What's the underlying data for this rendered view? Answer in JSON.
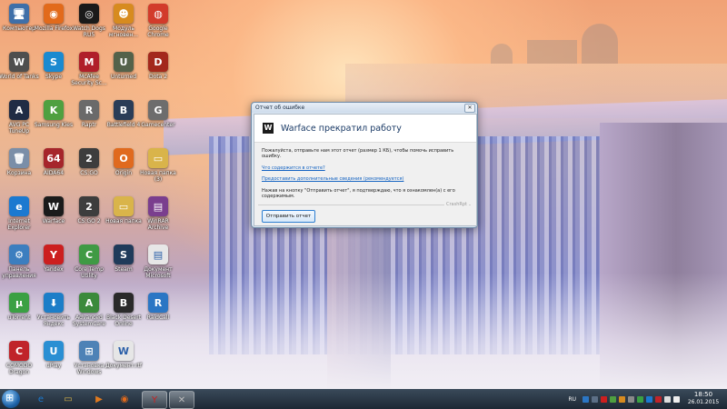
{
  "desktop": {
    "icons": [
      {
        "label": "Компьютер",
        "glyph": "🖥",
        "color": "#3f6fa8"
      },
      {
        "label": "Mozilla Firefox",
        "glyph": "◉",
        "color": "#e26a1b"
      },
      {
        "label": "Watch Dogs RU5",
        "glyph": "◎",
        "color": "#1a1a1a"
      },
      {
        "label": "Модуль мгновен...",
        "glyph": "☻",
        "color": "#d78b1f"
      },
      {
        "label": "Google Chrome",
        "glyph": "◍",
        "color": "#d23b2b"
      },
      {
        "label": "World of Tanks",
        "glyph": "W",
        "color": "#4e4e4e"
      },
      {
        "label": "Skype",
        "glyph": "S",
        "color": "#1b8ad0"
      },
      {
        "label": "McAfee Security Sc...",
        "glyph": "M",
        "color": "#b01e2a"
      },
      {
        "label": "Unturned",
        "glyph": "U",
        "color": "#54624a"
      },
      {
        "label": "Dota 2",
        "glyph": "D",
        "color": "#a3281c"
      },
      {
        "label": "AVG PC TuneUp",
        "glyph": "A",
        "color": "#202c44"
      },
      {
        "label": "Samsung Kies",
        "glyph": "K",
        "color": "#4fa040"
      },
      {
        "label": "Raptr",
        "glyph": "R",
        "color": "#6a6a6a"
      },
      {
        "label": "Battlefield 4",
        "glyph": "B",
        "color": "#2b3d57"
      },
      {
        "label": "Gamecenter",
        "glyph": "G",
        "color": "#6d6d6d"
      },
      {
        "label": "Корзина",
        "glyph": "🗑",
        "color": "#7a8ea8"
      },
      {
        "label": "AIDA64",
        "glyph": "64",
        "color": "#a6262b"
      },
      {
        "label": "CS:GO",
        "glyph": "2",
        "color": "#3d3d3d"
      },
      {
        "label": "Origin",
        "glyph": "O",
        "color": "#e06a1e"
      },
      {
        "label": "Новая папка (3)",
        "glyph": "▭",
        "color": "#d9b44a"
      },
      {
        "label": "Internet Explorer",
        "glyph": "e",
        "color": "#1b79d0"
      },
      {
        "label": "Warface",
        "glyph": "W",
        "color": "#1b1b1b"
      },
      {
        "label": "CS:GO 2",
        "glyph": "2",
        "color": "#3d3d3d"
      },
      {
        "label": "Новая папка",
        "glyph": "▭",
        "color": "#d9b44a"
      },
      {
        "label": "WinRAR Archive",
        "glyph": "▤",
        "color": "#7a3e8e"
      },
      {
        "label": "Панель управления",
        "glyph": "⚙",
        "color": "#3c7ebf"
      },
      {
        "label": "Yandex",
        "glyph": "Y",
        "color": "#cc1f1f"
      },
      {
        "label": "Core Temp Utility",
        "glyph": "C",
        "color": "#3f9a44"
      },
      {
        "label": "Steam",
        "glyph": "S",
        "color": "#1f3b5a"
      },
      {
        "label": "Документ Microsoft",
        "glyph": "▤",
        "color": "#e7e7e7"
      },
      {
        "label": "uTorrent",
        "glyph": "µ",
        "color": "#3aa043"
      },
      {
        "label": "Установить Яндекс",
        "glyph": "⬇",
        "color": "#1c7ec8"
      },
      {
        "label": "Advanced SystemCare",
        "glyph": "A",
        "color": "#3b8a3b"
      },
      {
        "label": "Black Desert Online",
        "glyph": "B",
        "color": "#2a2a2a"
      },
      {
        "label": "RaidCall",
        "glyph": "R",
        "color": "#2b76c4"
      },
      {
        "label": "COMODO Dragon",
        "glyph": "C",
        "color": "#c0242a"
      },
      {
        "label": "uPlay",
        "glyph": "U",
        "color": "#2a8fd3"
      },
      {
        "label": "Установка Windows",
        "glyph": "⊞",
        "color": "#4d82b6"
      },
      {
        "label": "Документ.rtf",
        "glyph": "W",
        "color": "#e6e6e6"
      }
    ]
  },
  "dialog": {
    "window_title": "Отчет об ошибке",
    "heading": "Warface прекратил работу",
    "message": "Пожалуйста, отправьте нам этот отчет (размер 1 КБ), чтобы помочь исправить ошибку.",
    "link_contents": "Что содержится в отчете?",
    "link_details": "Предоставить дополнительные сведения (рекомендуется)",
    "consent_text": "Нажав на кнопку \"Отправить отчет\", я подтверждаю, что я ознакомлен(а) с его содержимым.",
    "brand_tag": "CrashRpt",
    "send_button": "Отправить отчет",
    "close_glyph": "✕",
    "logo_glyph": "W"
  },
  "taskbar": {
    "pinned": [
      {
        "name": "internet-explorer",
        "glyph": "e",
        "color": "#1b79d0"
      },
      {
        "name": "file-explorer",
        "glyph": "▭",
        "color": "#d9b44a"
      },
      {
        "name": "media-player",
        "glyph": "▶",
        "color": "#e07a1f"
      },
      {
        "name": "firefox",
        "glyph": "◉",
        "color": "#e26a1b"
      },
      {
        "name": "yandex",
        "glyph": "Y",
        "color": "#cc1f1f"
      },
      {
        "name": "crash-report",
        "glyph": "✕",
        "color": "#bbbbbb"
      }
    ],
    "language": "RU",
    "time": "18:50",
    "date": "26.01.2015"
  }
}
